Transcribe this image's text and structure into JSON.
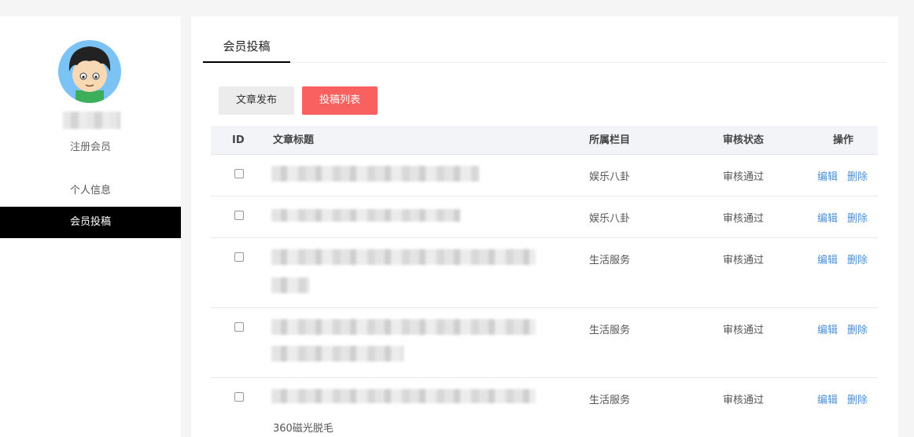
{
  "sidebar": {
    "role": "注册会员",
    "nav": [
      {
        "label": "个人信息",
        "active": false
      },
      {
        "label": "会员投稿",
        "active": true
      }
    ]
  },
  "main": {
    "tab": "会员投稿",
    "buttons": {
      "publish": "文章发布",
      "list": "投稿列表"
    },
    "table": {
      "headers": {
        "id": "ID",
        "title": "文章标题",
        "category": "所属栏目",
        "status": "审核状态",
        "action": "操作"
      },
      "rows": [
        {
          "category": "娱乐八卦",
          "status": "审核通过",
          "edit": "编辑",
          "delete": "删除"
        },
        {
          "category": "娱乐八卦",
          "status": "审核通过",
          "edit": "编辑",
          "delete": "删除"
        },
        {
          "category": "生活服务",
          "status": "审核通过",
          "edit": "编辑",
          "delete": "删除"
        },
        {
          "category": "生活服务",
          "status": "审核通过",
          "edit": "编辑",
          "delete": "删除"
        },
        {
          "category": "生活服务",
          "status": "审核通过",
          "edit": "编辑",
          "delete": "删除",
          "title_tail": "360磁光脱毛"
        }
      ]
    }
  },
  "colors": {
    "accent": "#f96160",
    "link": "#4a90d9",
    "active_nav": "#000000"
  }
}
